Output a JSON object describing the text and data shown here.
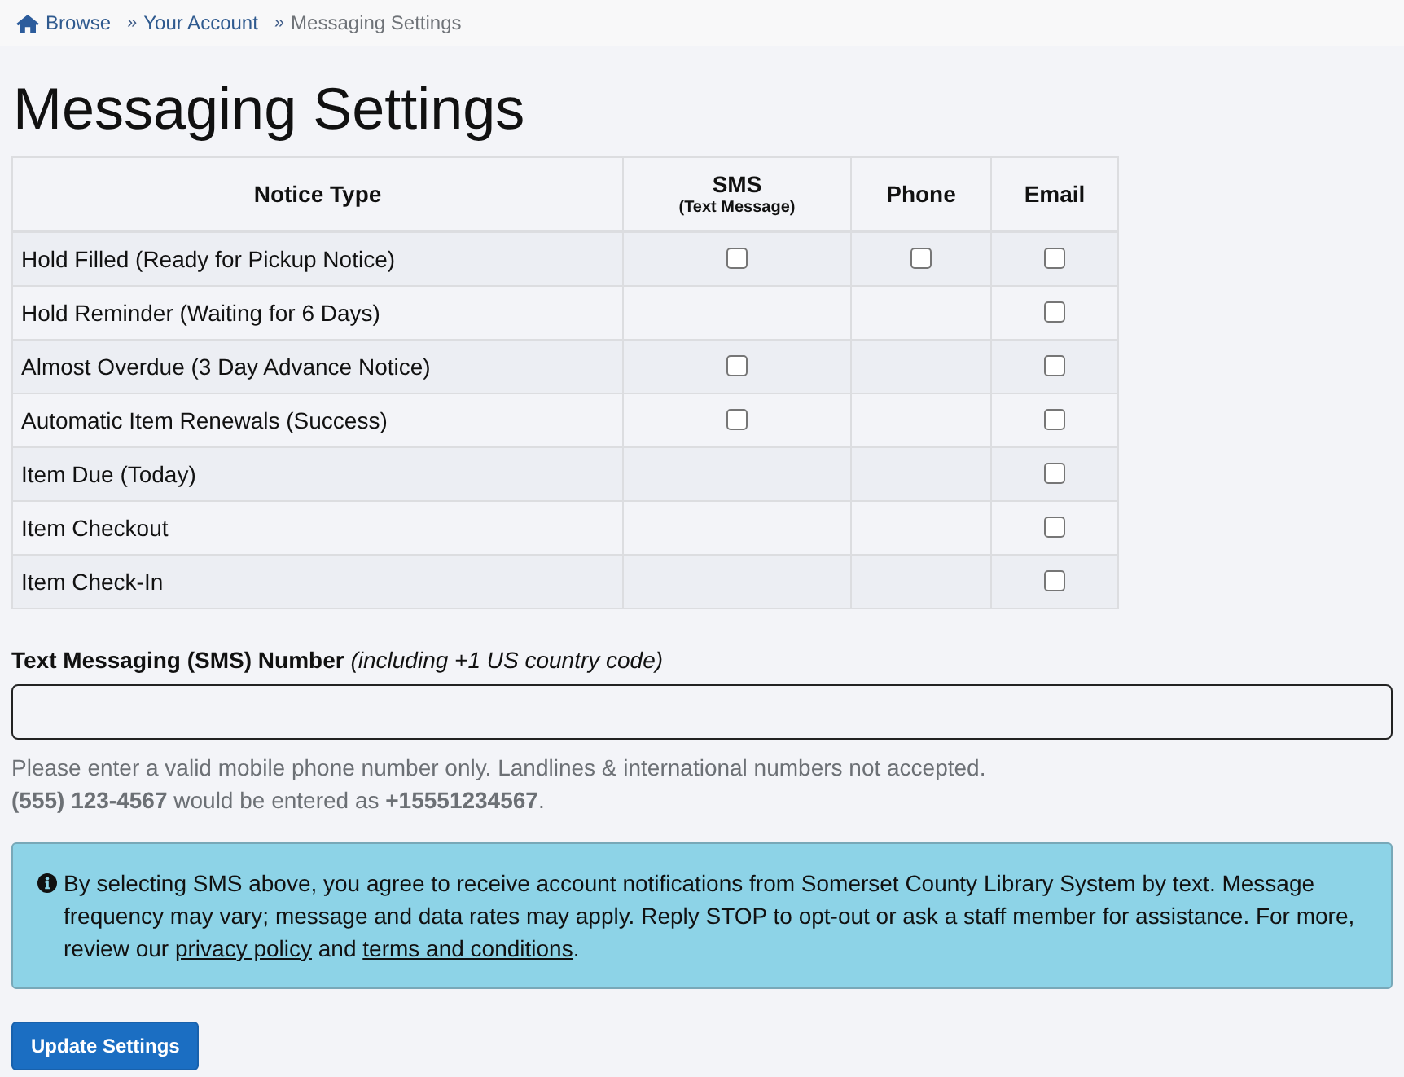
{
  "breadcrumbs": [
    {
      "label": "Browse",
      "current": false
    },
    {
      "separator": "»",
      "label": "Your Account",
      "current": false
    },
    {
      "separator": "»",
      "label": "Messaging Settings",
      "current": true
    }
  ],
  "title": "Messaging Settings",
  "table": {
    "columns": [
      {
        "label": "Notice Type"
      },
      {
        "label": "SMS",
        "sublabel": "(Text Message)"
      },
      {
        "label": "Phone"
      },
      {
        "label": "Email"
      }
    ],
    "rows": [
      {
        "notice": "Hold Filled (Ready for Pickup Notice)",
        "cells": [
          {
            "checked": false
          },
          {
            "checked": false
          },
          {
            "checked": false
          }
        ]
      },
      {
        "notice": "Hold Reminder (Waiting for 6 Days)",
        "cells": [
          null,
          null,
          {
            "checked": false
          }
        ]
      },
      {
        "notice": "Almost Overdue (3 Day Advance Notice)",
        "cells": [
          {
            "checked": false
          },
          null,
          {
            "checked": false
          }
        ]
      },
      {
        "notice": "Automatic Item Renewals (Success)",
        "cells": [
          {
            "checked": false
          },
          null,
          {
            "checked": false
          }
        ]
      },
      {
        "notice": "Item Due (Today)",
        "cells": [
          null,
          null,
          {
            "checked": false
          }
        ]
      },
      {
        "notice": "Item Checkout",
        "cells": [
          null,
          null,
          {
            "checked": false
          }
        ]
      },
      {
        "notice": "Item Check-In",
        "cells": [
          null,
          null,
          {
            "checked": false
          }
        ]
      }
    ]
  },
  "sms_number": {
    "label": "**Text Messaging (SMS) Number** *(including +1 US country code)*",
    "help": [
      "Please enter a valid mobile phone number only. Landlines & international numbers not accepted.",
      "**(555) 123-4567** would be entered as **+15551234567**."
    ]
  },
  "consent_notice": {
    "segments": [
      {
        "kind": "text",
        "text": "By selecting SMS above, you agree to receive account notifications from Somerset County Library System by text. Message frequency may vary; message and data rates may apply. Reply STOP to opt-out or ask a staff member for assistance. For more, review our "
      },
      {
        "kind": "link",
        "text": "privacy policy"
      },
      {
        "kind": "text",
        "text": " and "
      },
      {
        "kind": "link",
        "text": "terms and conditions"
      },
      {
        "kind": "text",
        "text": "."
      }
    ]
  },
  "buttons": [
    {
      "label": "Update Settings"
    }
  ]
}
